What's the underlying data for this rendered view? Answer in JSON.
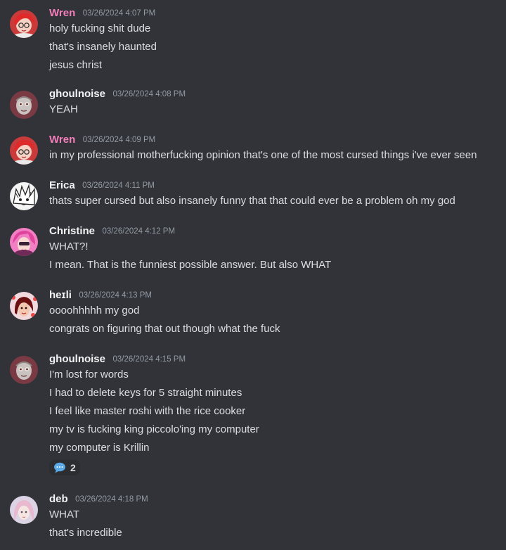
{
  "colors": {
    "background": "#313338",
    "text": "#dbdee1",
    "muted": "#949ba4",
    "wren_name": "#f47fbc",
    "default_name": "#f2f3f5"
  },
  "messages": [
    {
      "author": "Wren",
      "timestamp": "03/26/2024 4:07 PM",
      "avatar_icon": "avatar-wren",
      "lines": [
        "holy fucking shit dude",
        "that's insanely haunted",
        "jesus christ"
      ]
    },
    {
      "author": "ghoulnoise",
      "timestamp": "03/26/2024 4:08 PM",
      "avatar_icon": "avatar-ghoulnoise",
      "lines": [
        "YEAH"
      ]
    },
    {
      "author": "Wren",
      "timestamp": "03/26/2024 4:09 PM",
      "avatar_icon": "avatar-wren",
      "lines": [
        "in my professional motherfucking opinion that's one of the most cursed things i've ever seen"
      ]
    },
    {
      "author": "Erica",
      "timestamp": "03/26/2024 4:11 PM",
      "avatar_icon": "avatar-erica",
      "lines": [
        "thats super cursed but also insanely funny that that could ever be a problem oh my god"
      ]
    },
    {
      "author": "Christine",
      "timestamp": "03/26/2024 4:12 PM",
      "avatar_icon": "avatar-christine",
      "lines": [
        "WHAT?!",
        "I mean. That is the funniest possible answer. But also WHAT"
      ]
    },
    {
      "author": "heɪli",
      "timestamp": "03/26/2024 4:13 PM",
      "avatar_icon": "avatar-heili",
      "lines": [
        "oooohhhhh my god",
        "congrats on figuring that out though what the fuck"
      ]
    },
    {
      "author": "ghoulnoise",
      "timestamp": "03/26/2024 4:15 PM",
      "avatar_icon": "avatar-ghoulnoise",
      "lines": [
        "I'm lost for words",
        "I had to delete keys for 5 straight minutes",
        "I feel like master roshi with the rice cooker",
        "my tv is fucking king piccolo'ing my computer",
        "my computer is Krillin"
      ],
      "thread": {
        "icon": "speech-bubble-icon",
        "count": "2"
      }
    },
    {
      "author": "deb",
      "timestamp": "03/26/2024 4:18 PM",
      "avatar_icon": "avatar-deb",
      "lines": [
        "WHAT",
        "that's incredible"
      ]
    }
  ]
}
